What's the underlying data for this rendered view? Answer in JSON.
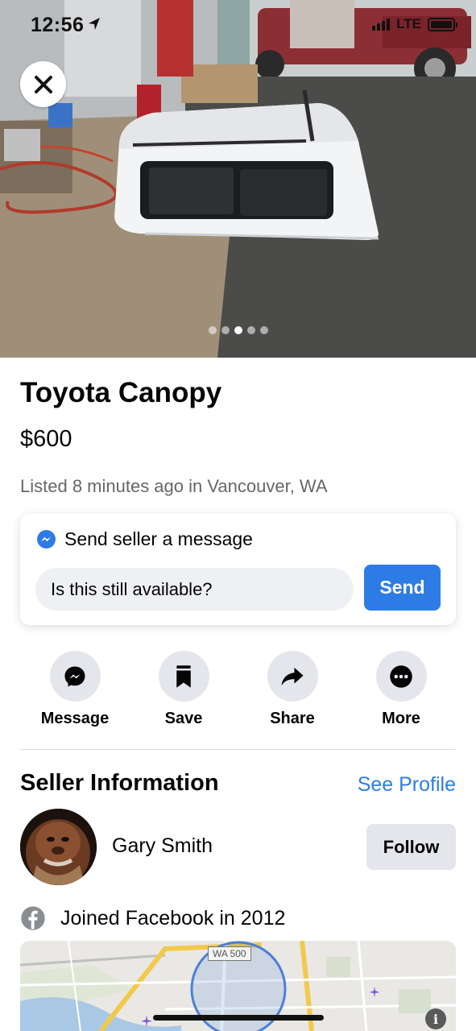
{
  "status_bar": {
    "time": "12:56",
    "network": "LTE",
    "icons": [
      "location-arrow-icon",
      "signal-icon",
      "battery-icon"
    ]
  },
  "gallery": {
    "photo_count": 5,
    "active_index": 2
  },
  "listing": {
    "title": "Toyota Canopy",
    "price": "$600",
    "listed": "Listed 8 minutes ago in Vancouver, WA"
  },
  "message_card": {
    "heading": "Send seller a message",
    "input_value": "Is this still available?",
    "send_label": "Send"
  },
  "actions": [
    {
      "label": "Message",
      "icon": "messenger-icon"
    },
    {
      "label": "Save",
      "icon": "bookmark-icon"
    },
    {
      "label": "Share",
      "icon": "share-arrow-icon"
    },
    {
      "label": "More",
      "icon": "more-dots-icon"
    }
  ],
  "seller": {
    "heading": "Seller Information",
    "see_profile": "See Profile",
    "name": "Gary Smith",
    "follow_label": "Follow",
    "joined": "Joined Facebook in 2012"
  },
  "map": {
    "road_label": "WA 500",
    "info": "i"
  },
  "colors": {
    "accent": "#2d7ce6",
    "button_gray": "#e4e6eb",
    "secondary_text": "#65676b"
  }
}
